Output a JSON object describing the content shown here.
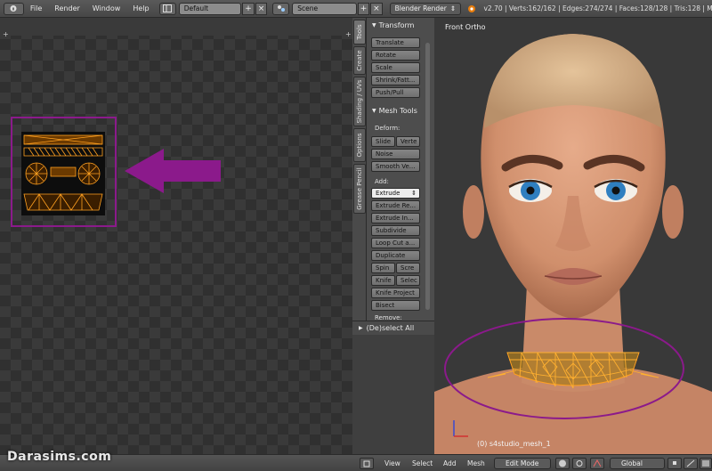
{
  "topbar": {
    "menus": [
      "File",
      "Render",
      "Window",
      "Help"
    ],
    "layout": "Default",
    "scene": "Scene",
    "engine": "Blender Render",
    "stats": "v2.70 | Verts:162/162 | Edges:274/274 | Faces:128/128 | Tris:128 | Mo"
  },
  "tool_tabs": [
    "Tools",
    "Create",
    "Shading / UVs",
    "Options",
    "Grease Pencil"
  ],
  "tool_shelf": {
    "transform_header": "Transform",
    "transform_buttons": [
      "Translate",
      "Rotate",
      "Scale",
      "Shrink/Fatt...",
      "Push/Pull"
    ],
    "mesh_tools_header": "Mesh Tools",
    "deform_label": "Deform:",
    "slide": "Slide",
    "vertex": "Verte",
    "noise": "Noise",
    "smooth": "Smooth Ve...",
    "add_label": "Add:",
    "extrude": "Extrude",
    "extrude_region": "Extrude Re...",
    "extrude_individual": "Extrude In...",
    "subdivide": "Subdivide",
    "loop_cut": "Loop Cut a...",
    "duplicate": "Duplicate",
    "spin": "Spin",
    "screw": "Scre",
    "knife": "Knife",
    "select": "Selec",
    "knife_project": "Knife Project",
    "bisect": "Bisect",
    "remove_label": "Remove:",
    "deselect_all": "(De)select All"
  },
  "viewport": {
    "view_label": "Front Ortho",
    "object_label": "(0) s4studio_mesh_1"
  },
  "bottombar": {
    "menus": [
      "View",
      "Select",
      "Add",
      "Mesh"
    ],
    "mode": "Edit Mode",
    "orientation": "Global"
  },
  "watermark": "Darasims.com",
  "colors": {
    "annotation": "#8b1a8b",
    "wire": "#ffa020",
    "viewport_bg": "#393939"
  }
}
